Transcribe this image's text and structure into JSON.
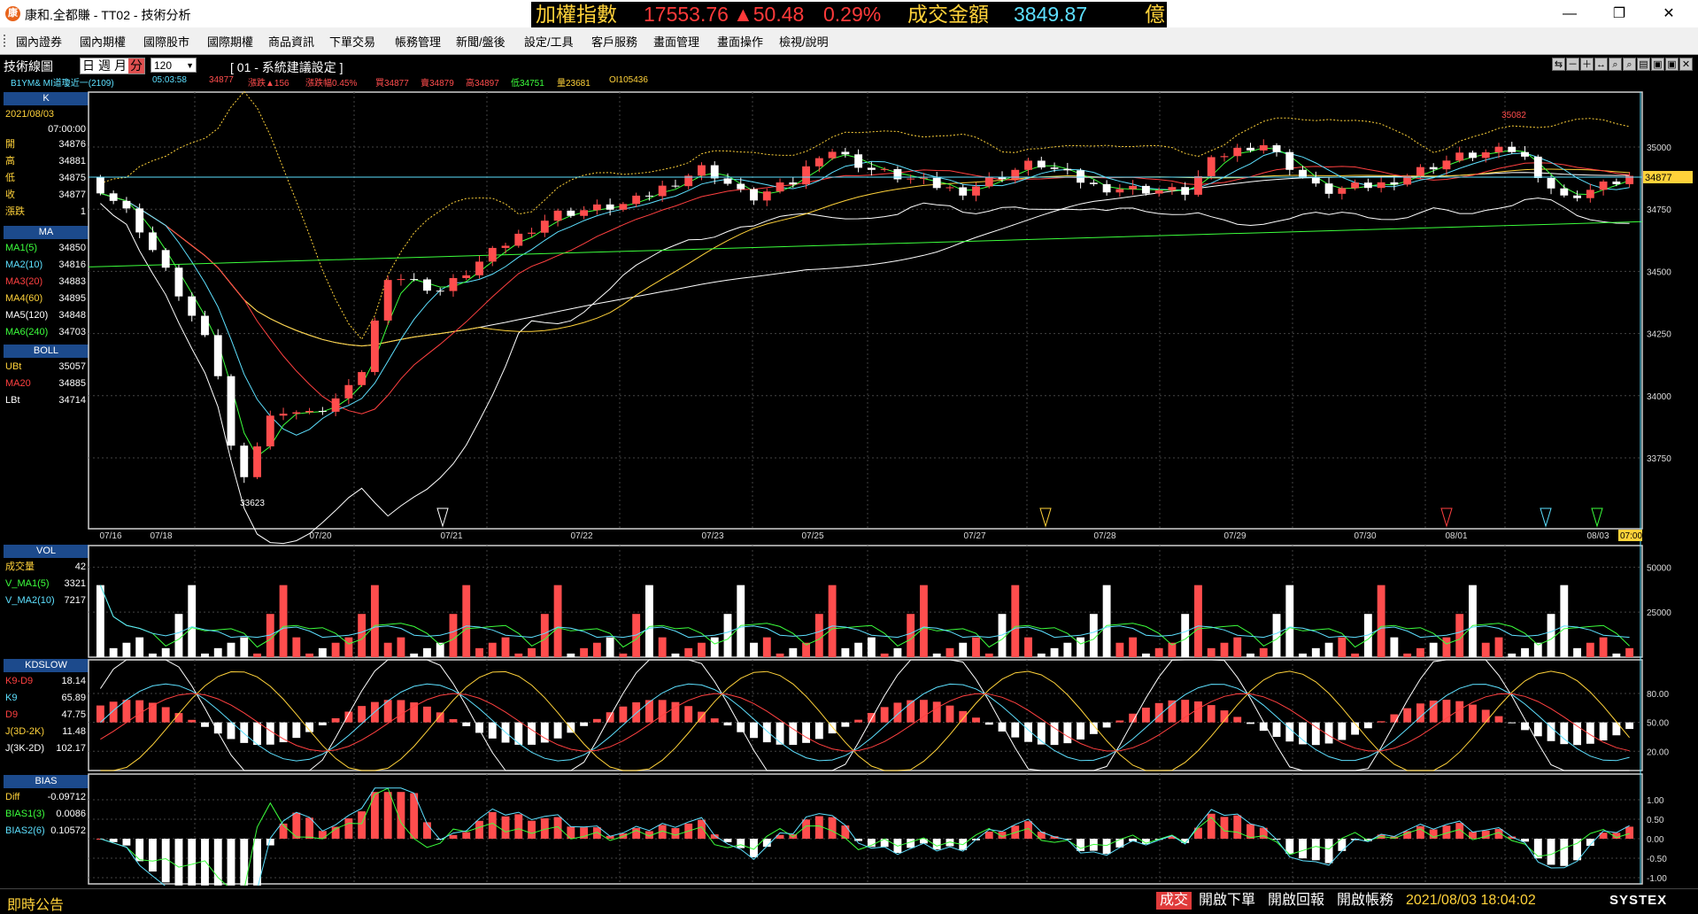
{
  "window": {
    "title": "康和.全都賺 - TT02 - 技術分析",
    "minimize": "—",
    "restore": "❐",
    "close": "✕"
  },
  "ticker": {
    "name": "加權指數",
    "value": "17553.76",
    "change": "▲50.48",
    "percent": "0.29%",
    "amount_label": "成交金額",
    "amount": "3849.87",
    "unit": "億"
  },
  "menu": {
    "items": [
      "國內證券",
      "國內期權",
      "國際股市",
      "國際期權",
      "商品資訊",
      "下單交易",
      "帳務管理",
      "新聞/盤後",
      "設定/工具",
      "客戶服務",
      "畫面管理",
      "畫面操作",
      "檢視/說明"
    ]
  },
  "toolbar": {
    "label": "技術線圖",
    "periods": [
      "日",
      "週",
      "月",
      "分"
    ],
    "active_period": "分",
    "count": "120",
    "setting": "[ 01 - 系統建議設定 ]",
    "icons": [
      "⇆",
      "－",
      "＋",
      "↔",
      "⌕",
      "⌕",
      "▤",
      "▣",
      "▣",
      "✕"
    ]
  },
  "info": {
    "symbol": "B1YM&  MI道瓊近一(2109)",
    "time": "05:03:58",
    "last": "34877",
    "change": "漲跌▲156",
    "pct": "漲跌幅0.45%",
    "buy": "買34877",
    "sell": "賣34879",
    "high": "高34897",
    "low": "低34751",
    "volume": "量23681",
    "oi": "OI105436"
  },
  "panel": {
    "k_title": "K",
    "date": "2021/08/03",
    "time": "07:00:00",
    "ohlc": [
      {
        "k": "開",
        "v": "34876"
      },
      {
        "k": "高",
        "v": "34881"
      },
      {
        "k": "低",
        "v": "34875"
      },
      {
        "k": "收",
        "v": "34877"
      },
      {
        "k": "漲跌",
        "v": "1"
      }
    ],
    "ma_title": "MA",
    "ma": [
      {
        "k": "MA1(5)",
        "v": "34850",
        "c": "#3cff3c"
      },
      {
        "k": "MA2(10)",
        "v": "34816",
        "c": "#5de0ff"
      },
      {
        "k": "MA3(20)",
        "v": "34883",
        "c": "#ff4040"
      },
      {
        "k": "MA4(60)",
        "v": "34895",
        "c": "#ffd23a"
      },
      {
        "k": "MA5(120)",
        "v": "34848",
        "c": "#ffffff"
      },
      {
        "k": "MA6(240)",
        "v": "34703",
        "c": "#3cff3c"
      }
    ],
    "boll_title": "BOLL",
    "boll": [
      {
        "k": "UBt",
        "v": "35057",
        "c": "#ffd23a"
      },
      {
        "k": "MA20",
        "v": "34885",
        "c": "#ff4040"
      },
      {
        "k": "LBt",
        "v": "34714",
        "c": "#ffffff"
      }
    ],
    "vol_title": "VOL",
    "vol": [
      {
        "k": "成交量",
        "v": "42",
        "c": "#ffd23a"
      },
      {
        "k": "V_MA1(5)",
        "v": "3321",
        "c": "#3cff3c"
      },
      {
        "k": "V_MA2(10)",
        "v": "7217",
        "c": "#5de0ff"
      }
    ],
    "kd_title": "KDSLOW",
    "kd": [
      {
        "k": "K9-D9",
        "v": "18.14",
        "c": "#ff4040"
      },
      {
        "k": "K9",
        "v": "65.89",
        "c": "#5de0ff"
      },
      {
        "k": "D9",
        "v": "47.75",
        "c": "#ff4040"
      },
      {
        "k": "J(3D-2K)",
        "v": "11.48",
        "c": "#ffd23a"
      },
      {
        "k": "J(3K-2D)",
        "v": "102.17",
        "c": "#ffffff"
      }
    ],
    "bias_title": "BIAS",
    "bias": [
      {
        "k": "Diff",
        "v": "-0.09712",
        "c": "#ffd23a"
      },
      {
        "k": "BIAS1(3)",
        "v": "0.0086",
        "c": "#3cff3c"
      },
      {
        "k": "BIAS2(6)",
        "v": "0.10572",
        "c": "#5de0ff"
      }
    ]
  },
  "chart": {
    "price_ticks": [
      "35000",
      "34750",
      "34500",
      "34250",
      "34000",
      "33750"
    ],
    "last_tag": "34877",
    "high_label": "35082",
    "low_label": "33623",
    "date_labels": [
      "07/16",
      "07/18",
      "07/20",
      "07/21",
      "07/22",
      "07/23",
      "07/25",
      "07/27",
      "07/28",
      "07/29",
      "07/30",
      "08/01",
      "08/03"
    ],
    "time_tag": "07:00",
    "vol_ticks": [
      "50000",
      "25000"
    ],
    "kd_ticks": [
      "80.00",
      "50.00",
      "20.00"
    ],
    "bias_ticks": [
      "1.00",
      "0.50",
      "0.00",
      "-0.50",
      "-1.00"
    ],
    "colors": {
      "up": "#ff4d4d",
      "down": "#ffffff",
      "ma5": "#3cff3c",
      "ma10": "#5de0ff",
      "ma20": "#ff4040",
      "ma60": "#ffd23a",
      "ma120": "#ffffff",
      "ma240": "#3cff3c"
    }
  },
  "status": {
    "left": "即時公告",
    "trade": "成交",
    "open_order": "開啟下單",
    "open_report": "開啟回報",
    "open_account": "開啟帳務",
    "datetime": "2021/08/03 18:04:02",
    "logo": "SYSTEX"
  }
}
